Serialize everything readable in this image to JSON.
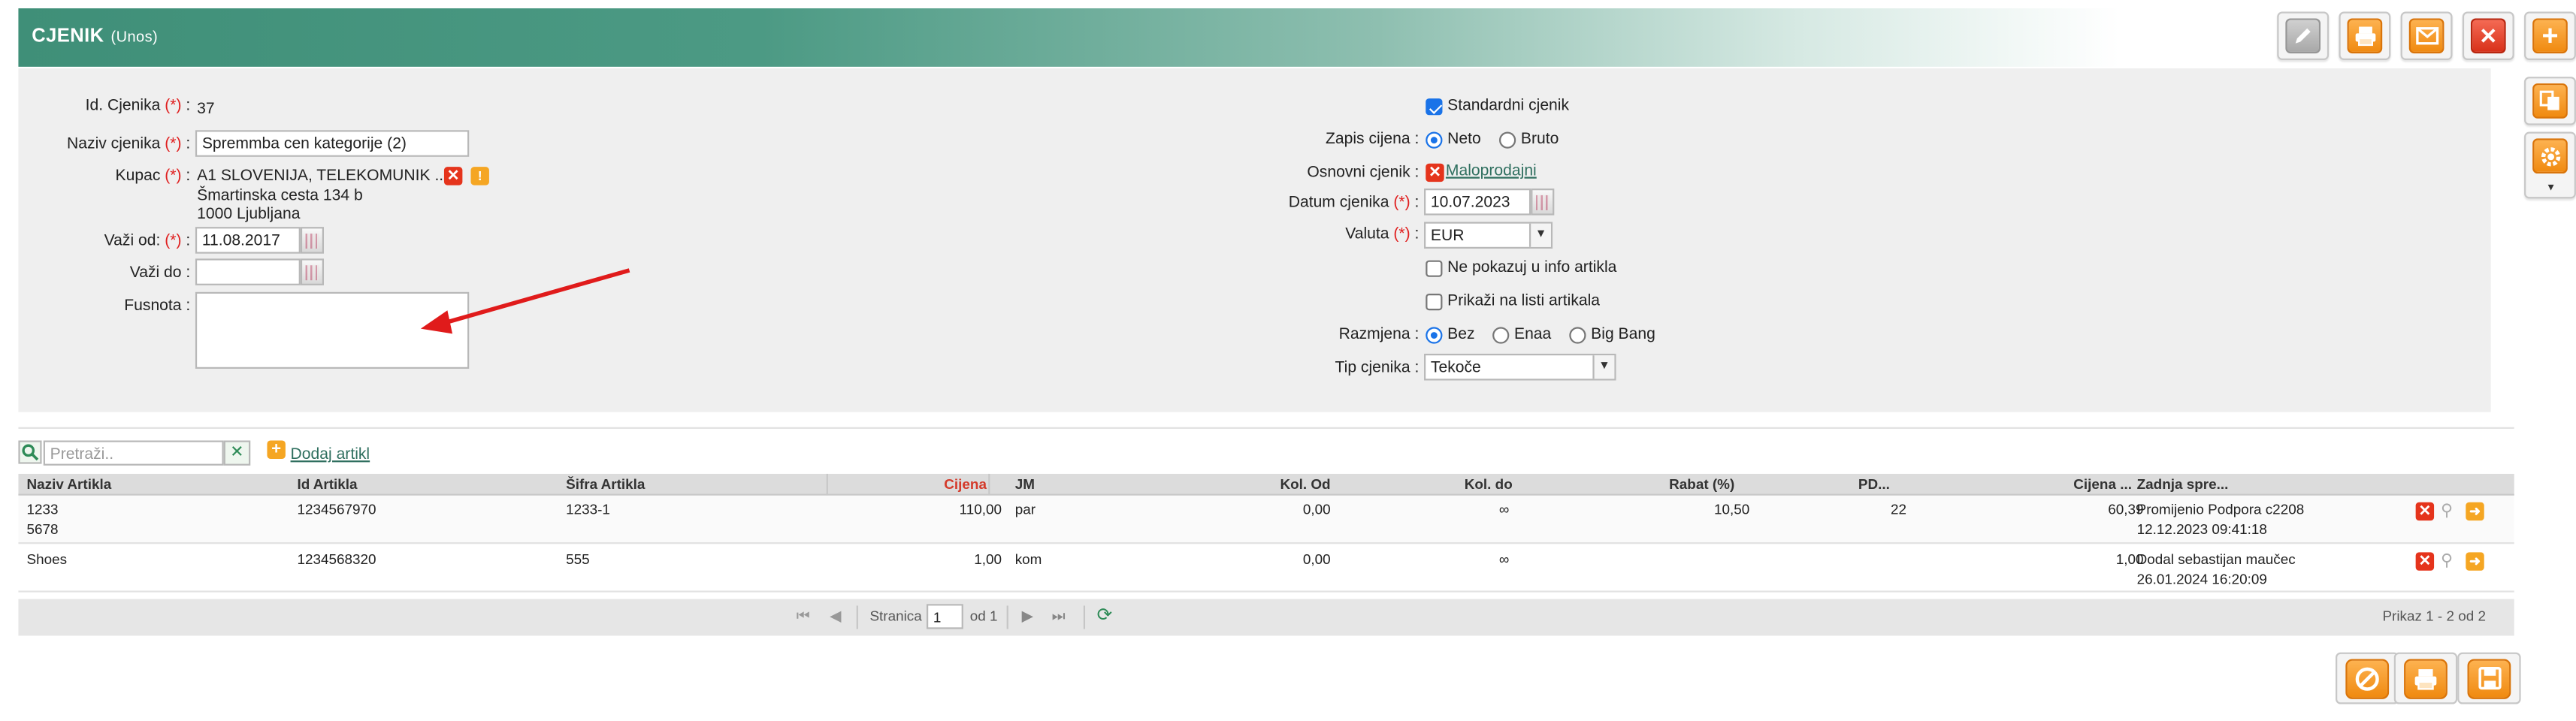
{
  "header": {
    "title": "CJENIK",
    "subtitle": "(Unos)"
  },
  "toolbar": {
    "buttons": [
      {
        "name": "edit",
        "icon": "pencil-icon"
      },
      {
        "name": "print",
        "icon": "printer-icon"
      },
      {
        "name": "email",
        "icon": "envelope-icon"
      },
      {
        "name": "delete",
        "icon": "close-icon"
      },
      {
        "name": "add",
        "icon": "plus-icon"
      }
    ],
    "side_buttons": [
      {
        "name": "copy",
        "icon": "copy-icon"
      },
      {
        "name": "settings",
        "icon": "gear-icon"
      }
    ]
  },
  "form": {
    "id_label": "Id. Cjenika",
    "id_value": "37",
    "naziv_label": "Naziv cjenika",
    "naziv_value": "Spremmba cen kategorije (2)",
    "kupac_label": "Kupac",
    "kupac_name": "A1 SLOVENIJA, TELEKOMUNIK ...",
    "kupac_street": "Šmartinska cesta 134 b",
    "kupac_city": "1000 Ljubljana",
    "vazi_od_label": "Važi od:",
    "vazi_od_value": "11.08.2017",
    "vazi_do_label": "Važi do",
    "vazi_do_value": "",
    "fusnota_label": "Fusnota",
    "fusnota_value": "",
    "required_mark": "(*)",
    "colon": ":",
    "standardni_label": "Standardni cjenik",
    "standardni_checked": true,
    "zapis_label": "Zapis cijena",
    "zapis_options": [
      "Neto",
      "Bruto"
    ],
    "zapis_selected": "Neto",
    "osnovni_label": "Osnovni cjenik",
    "osnovni_value": "Maloprodajni",
    "datum_label": "Datum cjenika",
    "datum_value": "10.07.2023",
    "valuta_label": "Valuta",
    "valuta_value": "EUR",
    "ne_pokazuj_label": "Ne pokazuj u info artikla",
    "prikazi_label": "Prikaži na listi artikala",
    "razmjena_label": "Razmjena",
    "razmjena_options": [
      "Bez",
      "Enaa",
      "Big Bang"
    ],
    "razmjena_selected": "Bez",
    "tip_label": "Tip cjenika",
    "tip_value": "Tekoče"
  },
  "search": {
    "placeholder": "Pretraži..",
    "add_label": "Dodaj artikl"
  },
  "grid": {
    "columns": [
      "Naziv Artikla",
      "Id Artikla",
      "Šifra Artikla",
      "Cijena",
      "JM",
      "Kol. Od",
      "Kol. do",
      "Rabat (%)",
      "PD...",
      "Cijena ...",
      "Zadnja spre..."
    ],
    "rows": [
      {
        "naziv": "1233",
        "naziv2": "5678",
        "id": "1234567970",
        "sifra": "1233-1",
        "cijena": "110,00",
        "jm": "par",
        "kol_od": "0,00",
        "kol_do": "∞",
        "rabat": "10,50",
        "pd": "22",
        "cijena2": "60,39",
        "zadnja": "Promijenio Podpora c2208",
        "zadnja_date": "12.12.2023 09:41:18"
      },
      {
        "naziv": "Shoes",
        "naziv2": "",
        "id": "1234568320",
        "sifra": "555",
        "cijena": "1,00",
        "jm": "kom",
        "kol_od": "0,00",
        "kol_do": "∞",
        "rabat": "",
        "pd": "",
        "cijena2": "1,00",
        "zadnja": "Dodal sebastijan maučec",
        "zadnja_date": "26.01.2024 16:20:09"
      }
    ]
  },
  "pager": {
    "page_label": "Stranica",
    "page_value": "1",
    "of_label": "od 1",
    "summary": "Prikaz 1 - 2 od 2"
  },
  "colors": {
    "header": "#3f8f78",
    "accent_orange": "#f08a10",
    "accent_red": "#d8311a",
    "link": "#2f6f5f",
    "required": "#e02020"
  }
}
